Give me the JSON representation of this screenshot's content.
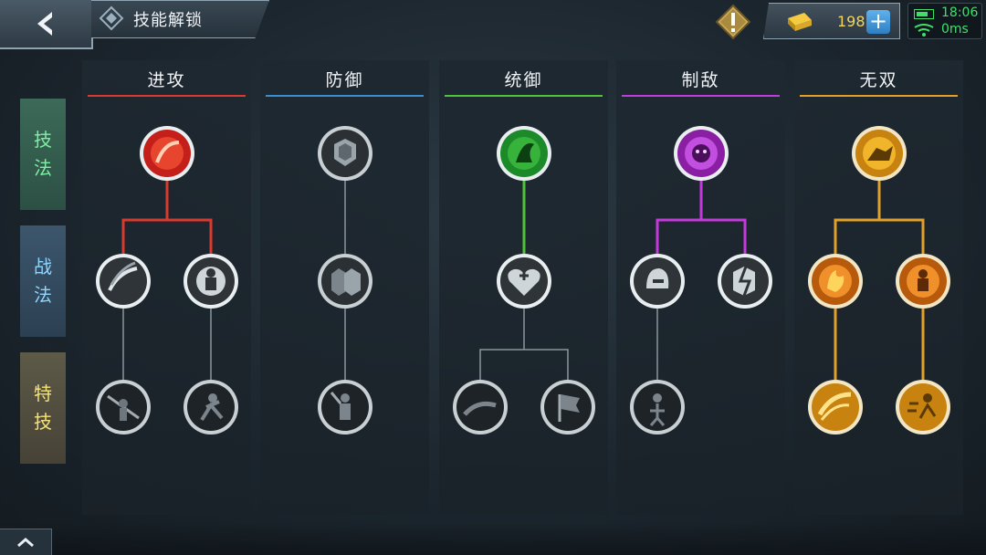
{
  "header": {
    "title": "技能解锁",
    "currency_amount": "198",
    "plus_label": "+",
    "time": "18:06",
    "ping": "0ms"
  },
  "categories": [
    {
      "line1": "技",
      "line2": "法"
    },
    {
      "line1": "战",
      "line2": "法"
    },
    {
      "line1": "特",
      "line2": "技"
    }
  ],
  "columns": [
    {
      "title": "进攻",
      "color": "#d93a2f",
      "top_active": true
    },
    {
      "title": "防御",
      "color": "#3a8fd4",
      "top_active": false
    },
    {
      "title": "统御",
      "color": "#4fc43a",
      "top_active": true
    },
    {
      "title": "制敌",
      "color": "#c23ad9",
      "top_active": true
    },
    {
      "title": "无双",
      "color": "#e0a02a",
      "top_active": true
    }
  ],
  "icons": {
    "back": "back-arrow-icon",
    "alert": "exclamation-icon",
    "gold": "gold-ingot-icon",
    "battery": "battery-icon",
    "wifi": "wifi-icon",
    "up": "chevron-up-icon"
  }
}
